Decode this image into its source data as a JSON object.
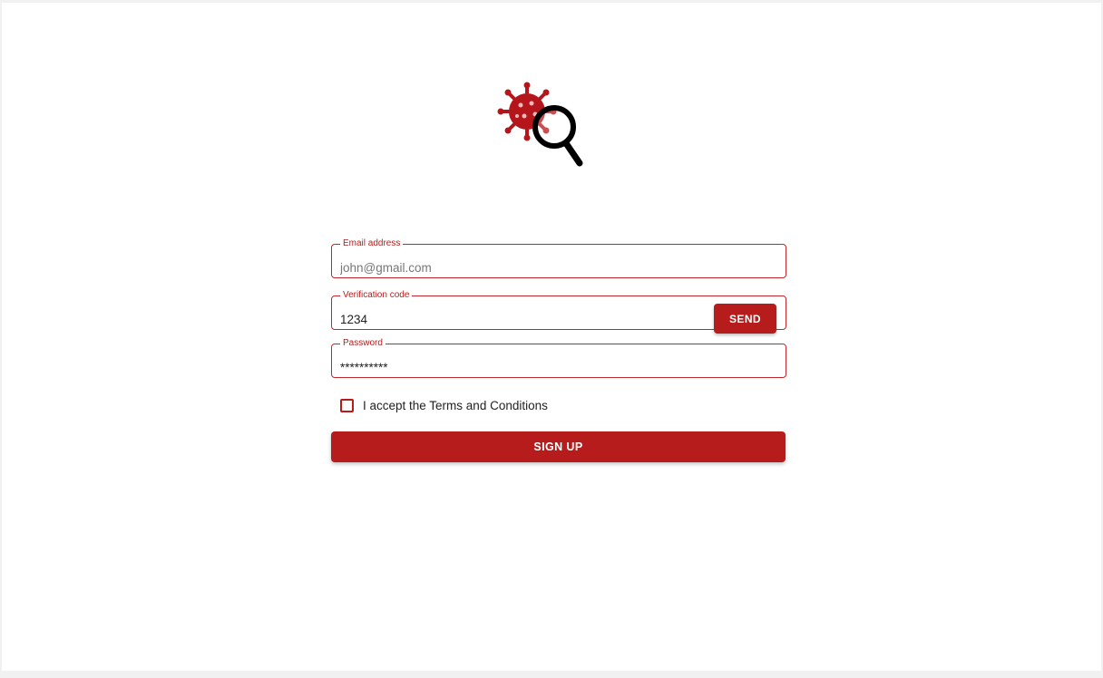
{
  "colors": {
    "accent": "#b71c1c",
    "background": "#ffffff",
    "page_border": "#f1f1f1"
  },
  "logo": {
    "icon": "virus-search-icon"
  },
  "form": {
    "email": {
      "label": "Email address",
      "placeholder": "john@gmail.com",
      "value": ""
    },
    "verification": {
      "label": "Verification code",
      "value": "1234",
      "send_label": "SEND"
    },
    "password": {
      "label": "Password",
      "value": "**********"
    },
    "terms": {
      "label": "I accept the Terms and Conditions",
      "checked": false
    },
    "signup_label": "SIGN UP"
  }
}
